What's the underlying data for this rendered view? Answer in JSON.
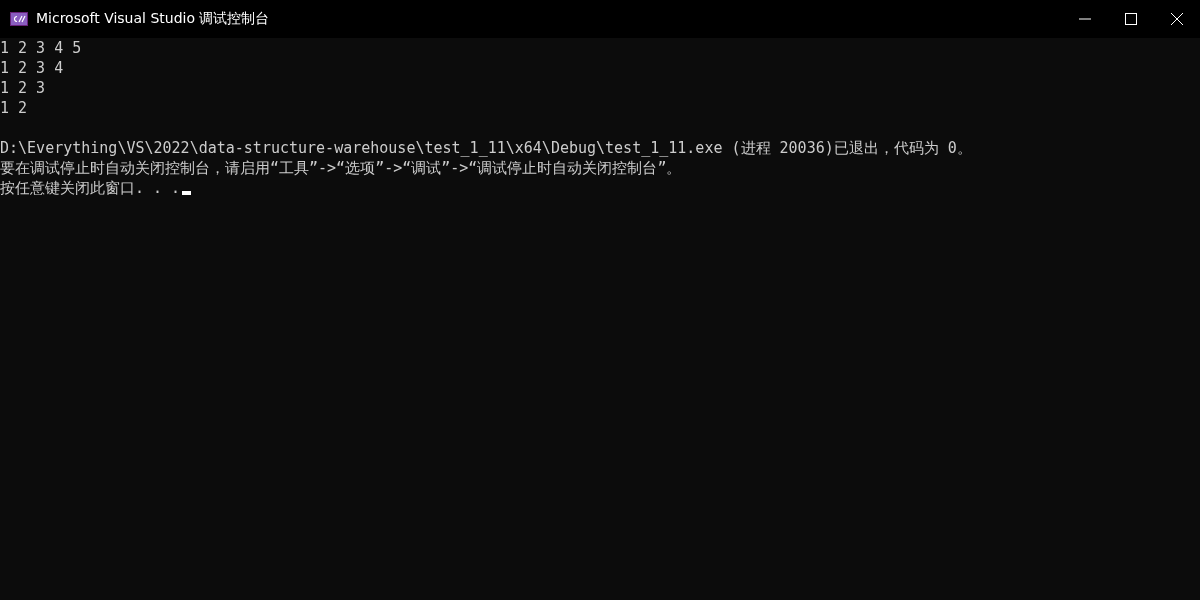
{
  "window": {
    "title": "Microsoft Visual Studio 调试控制台"
  },
  "console": {
    "blocks": [
      {
        "lines": [
          "1 2 3 4 5",
          "1 2 3 4",
          "1 2 3",
          "1 2"
        ]
      },
      {
        "lines": [
          "D:\\Everything\\VS\\2022\\data-structure-warehouse\\test_1_11\\x64\\Debug\\test_1_11.exe (进程 20036)已退出，代码为 0。",
          "要在调试停止时自动关闭控制台，请启用“工具”->“选项”->“调试”->“调试停止时自动关闭控制台”。",
          "按任意键关闭此窗口. . ."
        ]
      }
    ]
  }
}
